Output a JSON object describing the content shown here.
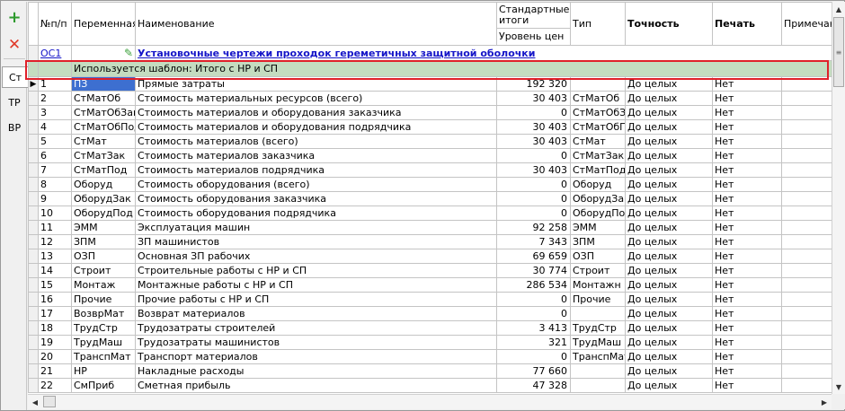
{
  "toolbar": {
    "add_icon": "plus-icon",
    "delete_icon": "cross-icon",
    "tabs": [
      {
        "label": "Ст",
        "active": true
      },
      {
        "label": "ТР",
        "active": false
      },
      {
        "label": "ВР",
        "active": false
      }
    ]
  },
  "grid": {
    "headers": {
      "num": "№п/п",
      "variable": "Переменная",
      "name": "Наименование",
      "std_totals": "Стандартные итоги",
      "price_level": "Уровень цен",
      "type": "Тип",
      "accuracy": "Точность",
      "print": "Печать",
      "note": "Примечание"
    },
    "section": {
      "code": "ОС1",
      "title": "Установочные чертежи проходок гереметичных защитной оболочки"
    },
    "template_note": "Используется шаблон: Итого с НР и СП",
    "rows": [
      {
        "n": "1",
        "var": "ПЗ",
        "name": "Прямые затраты",
        "value": "192 320",
        "type": "",
        "acc": "До целых",
        "print": "Нет"
      },
      {
        "n": "2",
        "var": "СтМатОб",
        "name": "Стоимость материальных ресурсов (всего)",
        "value": "30 403",
        "type": "СтМатОб",
        "acc": "До целых",
        "print": "Нет"
      },
      {
        "n": "3",
        "var": "СтМатОбЗак",
        "name": "Стоимость материалов и оборудования заказчика",
        "value": "0",
        "type": "СтМатОбЗак",
        "acc": "До целых",
        "print": "Нет"
      },
      {
        "n": "4",
        "var": "СтМатОбПод",
        "name": "Стоимость материалов и оборудования подрядчика",
        "value": "30 403",
        "type": "СтМатОбПод",
        "acc": "До целых",
        "print": "Нет"
      },
      {
        "n": "5",
        "var": "СтМат",
        "name": "Стоимость материалов (всего)",
        "value": "30 403",
        "type": "СтМат",
        "acc": "До целых",
        "print": "Нет"
      },
      {
        "n": "6",
        "var": "СтМатЗак",
        "name": "Стоимость материалов заказчика",
        "value": "0",
        "type": "СтМатЗак",
        "acc": "До целых",
        "print": "Нет"
      },
      {
        "n": "7",
        "var": "СтМатПод",
        "name": "Стоимость материалов подрядчика",
        "value": "30 403",
        "type": "СтМатПод",
        "acc": "До целых",
        "print": "Нет"
      },
      {
        "n": "8",
        "var": "Оборуд",
        "name": "Стоимость оборудования (всего)",
        "value": "0",
        "type": "Оборуд",
        "acc": "До целых",
        "print": "Нет"
      },
      {
        "n": "9",
        "var": "ОборудЗак",
        "name": "Стоимость оборудования заказчика",
        "value": "0",
        "type": "ОборудЗак",
        "acc": "До целых",
        "print": "Нет"
      },
      {
        "n": "10",
        "var": "ОборудПод",
        "name": "Стоимость оборудования подрядчика",
        "value": "0",
        "type": "ОборудПод",
        "acc": "До целых",
        "print": "Нет"
      },
      {
        "n": "11",
        "var": "ЭММ",
        "name": "Эксплуатация машин",
        "value": "92 258",
        "type": "ЭММ",
        "acc": "До целых",
        "print": "Нет"
      },
      {
        "n": "12",
        "var": "ЗПМ",
        "name": "ЗП машинистов",
        "value": "7 343",
        "type": "ЗПМ",
        "acc": "До целых",
        "print": "Нет"
      },
      {
        "n": "13",
        "var": "ОЗП",
        "name": "Основная ЗП рабочих",
        "value": "69 659",
        "type": "ОЗП",
        "acc": "До целых",
        "print": "Нет"
      },
      {
        "n": "14",
        "var": "Строит",
        "name": "Строительные работы с НР и СП",
        "value": "30 774",
        "type": "Строит",
        "acc": "До целых",
        "print": "Нет"
      },
      {
        "n": "15",
        "var": "Монтаж",
        "name": "Монтажные работы с НР и СП",
        "value": "286 534",
        "type": "Монтажн",
        "acc": "До целых",
        "print": "Нет"
      },
      {
        "n": "16",
        "var": "Прочие",
        "name": "Прочие работы с НР и СП",
        "value": "0",
        "type": "Прочие",
        "acc": "До целых",
        "print": "Нет"
      },
      {
        "n": "17",
        "var": "ВозврМат",
        "name": "Возврат материалов",
        "value": "0",
        "type": "",
        "acc": "До целых",
        "print": "Нет"
      },
      {
        "n": "18",
        "var": "ТрудСтр",
        "name": "Трудозатраты строителей",
        "value": "3 413",
        "type": "ТрудСтр",
        "acc": "До целых",
        "print": "Нет"
      },
      {
        "n": "19",
        "var": "ТрудМаш",
        "name": "Трудозатраты машинистов",
        "value": "321",
        "type": "ТрудМаш",
        "acc": "До целых",
        "print": "Нет"
      },
      {
        "n": "20",
        "var": "ТранспМат",
        "name": "Транспорт материалов",
        "value": "0",
        "type": "ТранспМат",
        "acc": "До целых",
        "print": "Нет"
      },
      {
        "n": "21",
        "var": "НР",
        "name": "Накладные расходы",
        "value": "77 660",
        "type": "",
        "acc": "До целых",
        "print": "Нет"
      },
      {
        "n": "22",
        "var": "СмПриб",
        "name": "Сметная прибыль",
        "value": "47 328",
        "type": "",
        "acc": "До целых",
        "print": "Нет"
      }
    ]
  },
  "colors": {
    "template_row_bg": "#c4dcc0",
    "highlight_border": "#e0202a",
    "link": "#1515c8",
    "selection": "#3d6fd0"
  }
}
